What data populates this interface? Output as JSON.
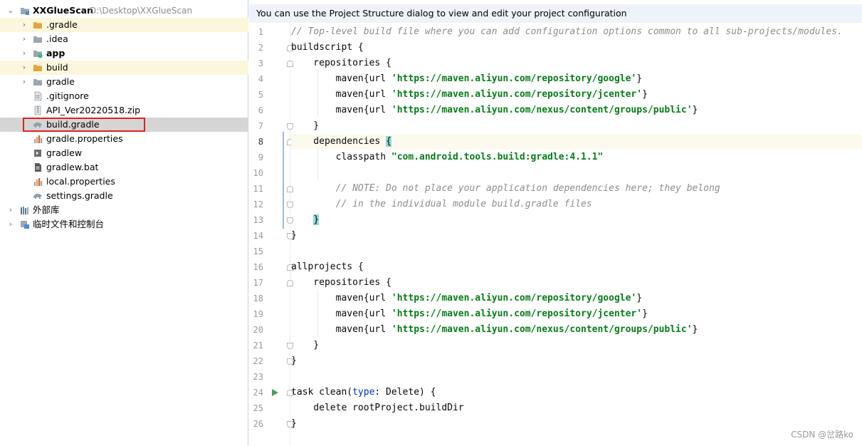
{
  "banner": {
    "text": "You can use the Project Structure dialog to view and edit your project configuration"
  },
  "tree": {
    "root": {
      "name": "XXGlueScan",
      "path": "D:\\Desktop\\XXGlueScan"
    },
    "items": [
      {
        "label": ".gradle",
        "kind": "folder-orange",
        "expandable": true,
        "excluded": true
      },
      {
        "label": ".idea",
        "kind": "folder-grey",
        "expandable": true
      },
      {
        "label": "app",
        "kind": "module",
        "expandable": true,
        "bold": true
      },
      {
        "label": "build",
        "kind": "folder-orange",
        "expandable": true,
        "excluded": true
      },
      {
        "label": "gradle",
        "kind": "folder-grey",
        "expandable": true
      },
      {
        "label": ".gitignore",
        "kind": "file-text"
      },
      {
        "label": "API_Ver20220518.zip",
        "kind": "file-zip"
      },
      {
        "label": "build.gradle",
        "kind": "file-gradle",
        "selected": true
      },
      {
        "label": "gradle.properties",
        "kind": "file-properties"
      },
      {
        "label": "gradlew",
        "kind": "file-exec"
      },
      {
        "label": "gradlew.bat",
        "kind": "file-bat"
      },
      {
        "label": "local.properties",
        "kind": "file-properties"
      },
      {
        "label": "settings.gradle",
        "kind": "file-gradle"
      }
    ],
    "external_libraries": "外部库",
    "scratches": "临时文件和控制台"
  },
  "editor": {
    "current_line": 8,
    "line_numbers": [
      "1",
      "2",
      "3",
      "4",
      "5",
      "6",
      "7",
      "8",
      "9",
      "10",
      "11",
      "12",
      "13",
      "14",
      "15",
      "16",
      "17",
      "18",
      "19",
      "20",
      "21",
      "22",
      "23",
      "24",
      "25",
      "26"
    ],
    "code": {
      "l1": "// Top-level build file where you can add configuration options common to all sub-projects/modules.",
      "l2": "buildscript {",
      "l3": "    repositories {",
      "l4_a": "        maven{url ",
      "l4_s": "'https://maven.aliyun.com/repository/google'",
      "l4_b": "}",
      "l5_a": "        maven{url ",
      "l5_s": "'https://maven.aliyun.com/repository/jcenter'",
      "l5_b": "}",
      "l6_a": "        maven{url ",
      "l6_s": "'https://maven.aliyun.com/nexus/content/groups/public'",
      "l6_b": "}",
      "l7": "    }",
      "l8_a": "    dependencies ",
      "l8_b": "{",
      "l9_a": "        classpath ",
      "l9_s": "\"com.android.tools.build:gradle:4.1.1\"",
      "l11": "        // NOTE: Do not place your application dependencies here; they belong",
      "l12": "        // in the individual module build.gradle files",
      "l13_a": "    ",
      "l13_b": "}",
      "l14": "}",
      "l16": "allprojects {",
      "l17": "    repositories {",
      "l18_a": "        maven{url ",
      "l18_s": "'https://maven.aliyun.com/repository/google'",
      "l18_b": "}",
      "l19_a": "        maven{url ",
      "l19_s": "'https://maven.aliyun.com/repository/jcenter'",
      "l19_b": "}",
      "l20_a": "        maven{url ",
      "l20_s": "'https://maven.aliyun.com/nexus/content/groups/public'",
      "l20_b": "}",
      "l21": "    }",
      "l22": "}",
      "l24_a": "task clean(",
      "l24_k": "type",
      "l24_b": ": Delete) {",
      "l25": "    delete rootProject.buildDir",
      "l26": "}"
    }
  },
  "watermark": "CSDN @岔路ko",
  "colors": {
    "comment": "#8c8c8c",
    "string": "#067d17",
    "keyword": "#0033b3",
    "selection": "#d5d5d5",
    "excluded": "#fcf7dc",
    "highlight_box": "#e02020"
  }
}
